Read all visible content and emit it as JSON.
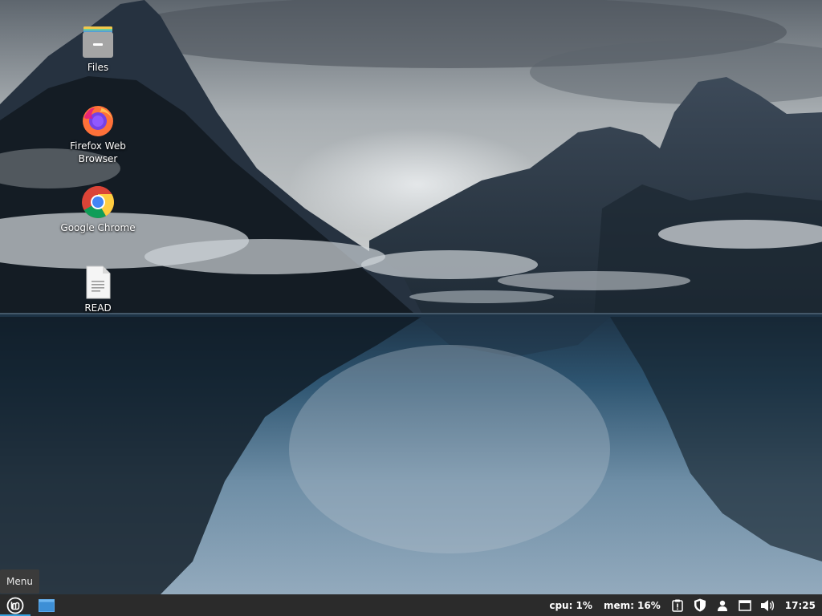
{
  "desktop": {
    "icons": [
      {
        "label": "Files",
        "icon": "folder-icon"
      },
      {
        "label": "Firefox Web Browser",
        "icon": "firefox-icon"
      },
      {
        "label": "Google Chrome",
        "icon": "chrome-icon"
      },
      {
        "label": "READ",
        "icon": "text-file-icon"
      }
    ]
  },
  "menu_tooltip": "Menu",
  "panel": {
    "cpu": "cpu: 1%",
    "mem": "mem: 16%",
    "clock": "17:25",
    "tray_icons": [
      "notification-icon",
      "shield-icon",
      "user-icon",
      "network-icon",
      "volume-icon"
    ],
    "accent_color": "#35a1de"
  }
}
